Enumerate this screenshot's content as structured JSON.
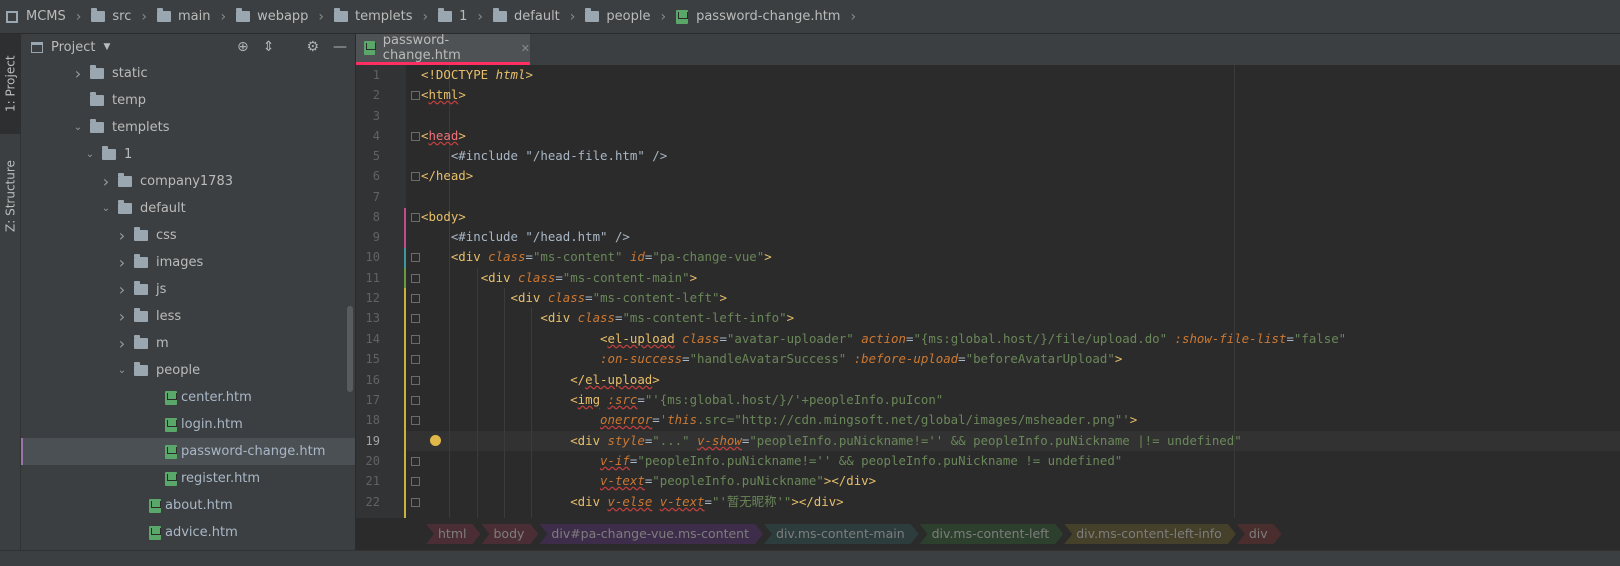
{
  "breadcrumb": {
    "items": [
      "MCMS",
      "src",
      "main",
      "webapp",
      "templets",
      "1",
      "default",
      "people",
      "password-change.htm"
    ]
  },
  "side_tabs": {
    "project": "1: Project",
    "structure": "Z: Structure"
  },
  "project_panel": {
    "title": "Project",
    "tree": [
      {
        "label": "static",
        "type": "folder",
        "state": "collapsed"
      },
      {
        "label": "temp",
        "type": "folder",
        "state": "none"
      },
      {
        "label": "templets",
        "type": "folder",
        "state": "expanded"
      },
      {
        "label": "1",
        "type": "folder",
        "state": "expanded"
      },
      {
        "label": "company1783",
        "type": "folder",
        "state": "collapsed"
      },
      {
        "label": "default",
        "type": "folder",
        "state": "expanded"
      },
      {
        "label": "css",
        "type": "folder",
        "state": "collapsed"
      },
      {
        "label": "images",
        "type": "folder",
        "state": "collapsed"
      },
      {
        "label": "js",
        "type": "folder",
        "state": "collapsed"
      },
      {
        "label": "less",
        "type": "folder",
        "state": "collapsed"
      },
      {
        "label": "m",
        "type": "folder",
        "state": "collapsed"
      },
      {
        "label": "people",
        "type": "folder",
        "state": "expanded"
      },
      {
        "label": "center.htm",
        "type": "htm"
      },
      {
        "label": "login.htm",
        "type": "htm"
      },
      {
        "label": "password-change.htm",
        "type": "htm",
        "selected": true
      },
      {
        "label": "register.htm",
        "type": "htm"
      },
      {
        "label": "about.htm",
        "type": "htm"
      },
      {
        "label": "advice.htm",
        "type": "htm"
      }
    ]
  },
  "editor": {
    "tab": "password-change.htm",
    "current_line": 19,
    "line_numbers": [
      "1",
      "2",
      "3",
      "4",
      "5",
      "6",
      "7",
      "8",
      "9",
      "10",
      "11",
      "12",
      "13",
      "14",
      "15",
      "16",
      "17",
      "18",
      "19",
      "20",
      "21",
      "22"
    ]
  },
  "structure_path": [
    "html",
    "body",
    "div#pa-change-vue.ms-content",
    "div.ms-content-main",
    "div.ms-content-left",
    "div.ms-content-left-info",
    "div"
  ],
  "colors": {
    "tab_underline": "#ff2e63",
    "tag": "#e8bf6a",
    "attr_value": "#6a8759",
    "keyword": "#cc7832"
  }
}
